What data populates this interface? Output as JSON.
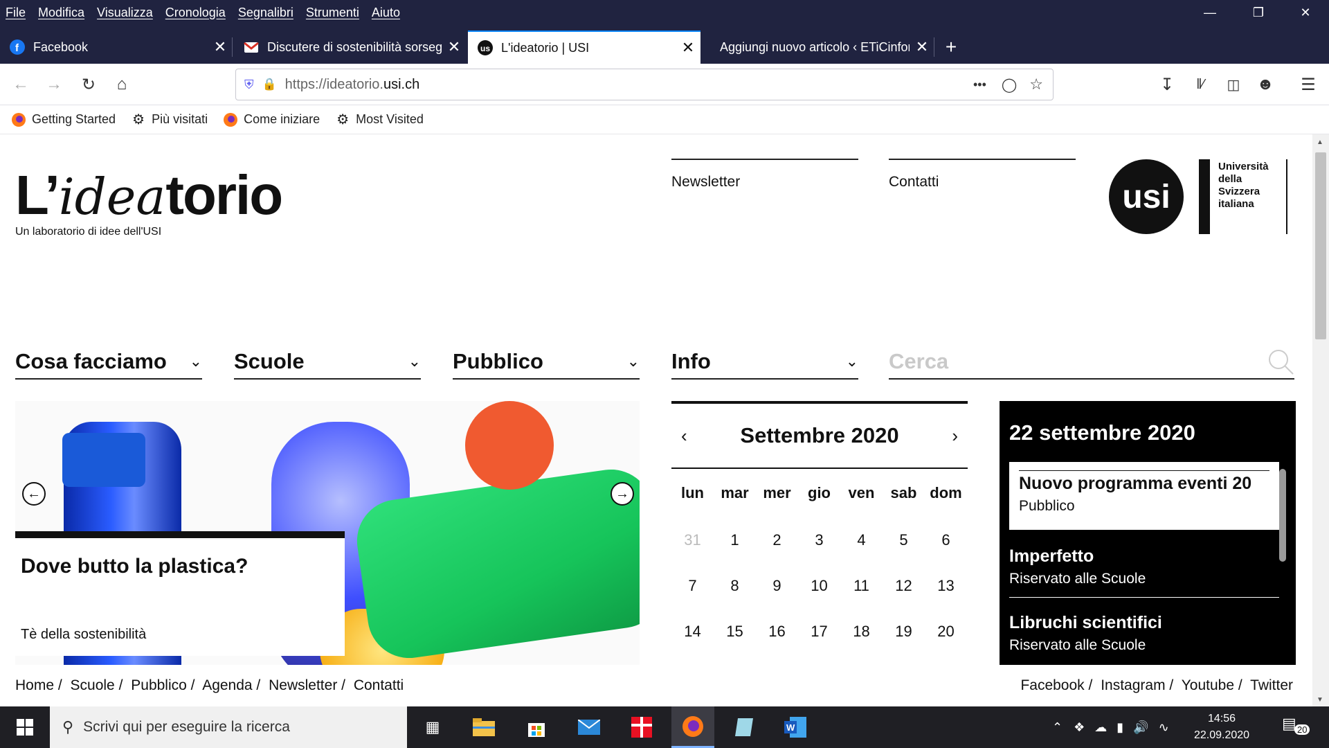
{
  "menubar": {
    "items": [
      "File",
      "Modifica",
      "Visualizza",
      "Cronologia",
      "Segnalibri",
      "Strumenti",
      "Aiuto"
    ]
  },
  "tabs": [
    {
      "title": "Facebook",
      "icon": "facebook-icon",
      "active": false
    },
    {
      "title": "Discutere di sostenibilità sorseggiando",
      "icon": "gmail-icon",
      "active": false
    },
    {
      "title": "L'ideatorio | USI",
      "icon": "usi-favicon-icon",
      "active": true
    },
    {
      "title": "Aggiungi nuovo articolo ‹ ETiCinfor",
      "icon": "none",
      "active": false
    }
  ],
  "urlbar": {
    "url_prefix": "https://ideatorio.",
    "url_domain": "usi.ch",
    "more": "•••"
  },
  "bookmarks": [
    {
      "label": "Getting Started",
      "icon": "firefox-icon"
    },
    {
      "label": "Più visitati",
      "icon": "gear-icon"
    },
    {
      "label": "Come iniziare",
      "icon": "firefox-icon"
    },
    {
      "label": "Most Visited",
      "icon": "gear-icon"
    }
  ],
  "site": {
    "logo_prefix": "L’",
    "logo_script": "idea",
    "logo_suffix": "torio",
    "tagline": "Un laboratorio di idee dell'USI",
    "top_links": [
      "Newsletter",
      "Contatti"
    ],
    "usi_mark": "usi",
    "usi_name": [
      "Università",
      "della",
      "Svizzera",
      "italiana"
    ],
    "nav": [
      "Cosa facciamo",
      "Scuole",
      "Pubblico",
      "Info"
    ],
    "search_placeholder": "Cerca"
  },
  "slide": {
    "title": "Dove butto la plastica?",
    "subtitle": "Tè della sostenibilità"
  },
  "calendar": {
    "month": "Settembre 2020",
    "weekdays": [
      "lun",
      "mar",
      "mer",
      "gio",
      "ven",
      "sab",
      "dom"
    ],
    "weeks": [
      [
        "31",
        "1",
        "2",
        "3",
        "4",
        "5",
        "6"
      ],
      [
        "7",
        "8",
        "9",
        "10",
        "11",
        "12",
        "13"
      ],
      [
        "14",
        "15",
        "16",
        "17",
        "18",
        "19",
        "20"
      ]
    ]
  },
  "events": {
    "date": "22 settembre 2020",
    "items": [
      {
        "title": "Nuovo programma eventi 20",
        "category": "Pubblico"
      },
      {
        "title": "Imperfetto",
        "category": "Riservato alle Scuole"
      },
      {
        "title": "Libruchi scientifici",
        "category": "Riservato alle Scuole"
      }
    ]
  },
  "footer": {
    "left": [
      "Home /",
      "Scuole /",
      "Pubblico /",
      "Agenda /",
      "Newsletter /",
      "Contatti"
    ],
    "right": [
      "Facebook /",
      "Instagram /",
      "Youtube /",
      "Twitter"
    ]
  },
  "taskbar": {
    "search_placeholder": "Scrivi qui per eseguire la ricerca",
    "time": "14:56",
    "date": "22.09.2020",
    "notifications": "20"
  },
  "colors": {
    "chrome": "#202340",
    "accent": "#0a84ff",
    "orange_dot": "#f05a30"
  }
}
